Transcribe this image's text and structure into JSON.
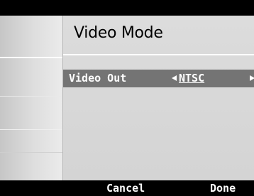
{
  "screen": {
    "title": "Video Mode"
  },
  "setting": {
    "label": "Video Out",
    "value": "NTSC",
    "decrease_icon": "left-arrow-icon",
    "increase_icon": "right-arrow-icon"
  },
  "softkeys": {
    "cancel_label": "Cancel",
    "done_label": "Done"
  }
}
